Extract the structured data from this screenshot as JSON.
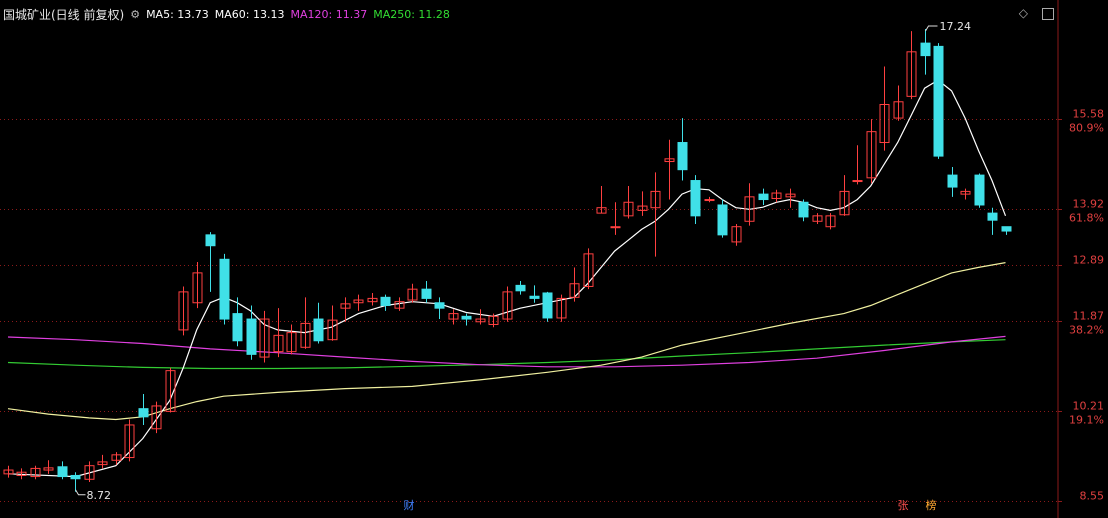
{
  "header": {
    "title": "国城矿业(日线 前复权)",
    "gear_icon": "gear-icon",
    "ma": [
      {
        "text": "MA5: 13.73",
        "color": "#ffffff"
      },
      {
        "text": "MA60: 13.13",
        "color": "#ffffff"
      },
      {
        "text": "MA120: 11.37",
        "color": "#e040e0"
      },
      {
        "text": "MA250: 11.28",
        "color": "#33dd33"
      }
    ]
  },
  "toolbar": {
    "diamond_icon": "diamond-icon",
    "window_icon": "window-icon"
  },
  "badges": {
    "cai": "财",
    "zhang": "张",
    "bang": "榜"
  },
  "colors": {
    "up": "#ff4040",
    "down": "#40e0e8",
    "ma5": "#ffffff",
    "ma60": "#f0f0a0",
    "ma120": "#e040e0",
    "ma250": "#33cc33",
    "grid": "#8b1a1a"
  },
  "chart_data": {
    "type": "candlestick",
    "title": "国城矿业(日线 前复权)",
    "price_range": [
      8.55,
      17.24
    ],
    "y_ticks": [
      {
        "price": 15.58,
        "label": "15.58",
        "pct": "80.9%"
      },
      {
        "price": 13.92,
        "label": "13.92",
        "pct": "61.8%"
      },
      {
        "price": 12.89,
        "label": "12.89",
        "pct": ""
      },
      {
        "price": 11.87,
        "label": "11.87",
        "pct": "38.2%"
      },
      {
        "price": 10.21,
        "label": "10.21",
        "pct": "19.1%"
      },
      {
        "price": 8.55,
        "label": "8.55",
        "pct": ""
      }
    ],
    "annotations": [
      {
        "text": "17.24",
        "type": "high"
      },
      {
        "text": "8.72",
        "type": "low"
      }
    ],
    "candles": [
      [
        9.05,
        9.12,
        8.98,
        9.2
      ],
      [
        9.02,
        9.08,
        8.95,
        9.15
      ],
      [
        9.0,
        9.15,
        8.95,
        9.2
      ],
      [
        9.12,
        9.16,
        9.05,
        9.3
      ],
      [
        9.18,
        9.0,
        8.95,
        9.28
      ],
      [
        9.02,
        8.96,
        8.72,
        9.08
      ],
      [
        8.95,
        9.2,
        8.9,
        9.28
      ],
      [
        9.22,
        9.27,
        9.15,
        9.4
      ],
      [
        9.3,
        9.4,
        9.22,
        9.45
      ],
      [
        9.35,
        9.95,
        9.28,
        10.05
      ],
      [
        10.25,
        10.1,
        9.95,
        10.52
      ],
      [
        9.88,
        10.3,
        9.8,
        10.38
      ],
      [
        10.2,
        10.95,
        10.18,
        11.0
      ],
      [
        11.7,
        12.4,
        11.6,
        12.5
      ],
      [
        12.2,
        12.75,
        12.1,
        12.95
      ],
      [
        13.45,
        13.25,
        12.4,
        13.5
      ],
      [
        13.0,
        11.9,
        11.8,
        13.1
      ],
      [
        12.0,
        11.5,
        11.4,
        12.3
      ],
      [
        11.9,
        11.25,
        11.15,
        12.15
      ],
      [
        11.2,
        11.9,
        11.1,
        12.05
      ],
      [
        11.3,
        11.6,
        11.2,
        12.1
      ],
      [
        11.3,
        11.65,
        11.25,
        11.8
      ],
      [
        11.38,
        11.82,
        11.35,
        12.3
      ],
      [
        11.9,
        11.5,
        11.45,
        12.2
      ],
      [
        11.52,
        11.88,
        11.5,
        12.15
      ],
      [
        12.1,
        12.18,
        11.85,
        12.3
      ],
      [
        12.2,
        12.25,
        12.05,
        12.35
      ],
      [
        12.22,
        12.28,
        12.15,
        12.38
      ],
      [
        12.3,
        12.15,
        12.05,
        12.35
      ],
      [
        12.1,
        12.22,
        12.05,
        12.3
      ],
      [
        12.25,
        12.45,
        12.2,
        12.55
      ],
      [
        12.45,
        12.28,
        12.2,
        12.6
      ],
      [
        12.2,
        12.1,
        11.9,
        12.3
      ],
      [
        11.9,
        12.0,
        11.8,
        12.08
      ],
      [
        11.95,
        11.9,
        11.78,
        12.0
      ],
      [
        11.85,
        11.9,
        11.8,
        12.08
      ],
      [
        11.8,
        11.95,
        11.75,
        12.0
      ],
      [
        11.9,
        12.4,
        11.85,
        12.5
      ],
      [
        12.52,
        12.42,
        12.35,
        12.6
      ],
      [
        12.32,
        12.28,
        12.2,
        12.52
      ],
      [
        12.38,
        11.92,
        11.85,
        12.4
      ],
      [
        11.92,
        12.28,
        11.85,
        12.35
      ],
      [
        12.3,
        12.55,
        12.22,
        12.85
      ],
      [
        12.5,
        13.1,
        12.45,
        13.2
      ],
      [
        13.85,
        13.95,
        13.85,
        14.35
      ],
      [
        13.6,
        13.6,
        13.45,
        14.05
      ],
      [
        13.8,
        14.05,
        13.75,
        14.35
      ],
      [
        13.9,
        13.98,
        13.8,
        14.25
      ],
      [
        13.95,
        14.25,
        13.05,
        14.6
      ],
      [
        14.8,
        14.85,
        14.1,
        15.2
      ],
      [
        15.15,
        14.65,
        14.45,
        15.6
      ],
      [
        14.45,
        13.8,
        13.65,
        14.55
      ],
      [
        14.1,
        14.1,
        14.05,
        14.15
      ],
      [
        14.0,
        13.45,
        13.4,
        14.1
      ],
      [
        13.32,
        13.6,
        13.25,
        13.65
      ],
      [
        13.7,
        14.15,
        13.62,
        14.4
      ],
      [
        14.2,
        14.1,
        14.0,
        14.3
      ],
      [
        14.12,
        14.22,
        14.05,
        14.28
      ],
      [
        14.15,
        14.2,
        13.95,
        14.3
      ],
      [
        14.05,
        13.78,
        13.7,
        14.1
      ],
      [
        13.7,
        13.8,
        13.65,
        13.85
      ],
      [
        13.6,
        13.8,
        13.55,
        13.85
      ],
      [
        13.82,
        14.25,
        13.8,
        14.55
      ],
      [
        14.45,
        14.45,
        14.38,
        15.1
      ],
      [
        14.5,
        15.35,
        14.4,
        15.58
      ],
      [
        15.15,
        15.85,
        15.0,
        16.55
      ],
      [
        15.6,
        15.9,
        15.55,
        16.2
      ],
      [
        16.0,
        16.82,
        15.95,
        17.2
      ],
      [
        16.98,
        16.75,
        16.4,
        17.24
      ],
      [
        16.92,
        14.9,
        14.85,
        16.98
      ],
      [
        14.55,
        14.33,
        14.15,
        14.7
      ],
      [
        14.2,
        14.25,
        14.1,
        14.3
      ],
      [
        14.55,
        14.0,
        13.95,
        14.58
      ],
      [
        13.85,
        13.72,
        13.45,
        13.95
      ],
      [
        13.6,
        13.52,
        13.45,
        13.6
      ]
    ],
    "ma": {
      "MA5": [
        [
          0,
          9.05
        ],
        [
          5,
          9.0
        ],
        [
          8,
          9.2
        ],
        [
          10,
          9.7
        ],
        [
          12,
          10.4
        ],
        [
          13,
          11.0
        ],
        [
          14,
          11.7
        ],
        [
          15,
          12.2
        ],
        [
          16,
          12.3
        ],
        [
          17,
          12.2
        ],
        [
          18,
          12.05
        ],
        [
          19,
          11.8
        ],
        [
          20,
          11.7
        ],
        [
          22,
          11.65
        ],
        [
          24,
          11.75
        ],
        [
          26,
          12.0
        ],
        [
          28,
          12.15
        ],
        [
          30,
          12.22
        ],
        [
          32,
          12.18
        ],
        [
          34,
          12.02
        ],
        [
          36,
          11.95
        ],
        [
          38,
          12.1
        ],
        [
          40,
          12.2
        ],
        [
          42,
          12.3
        ],
        [
          43,
          12.55
        ],
        [
          44,
          12.85
        ],
        [
          45,
          13.15
        ],
        [
          46,
          13.35
        ],
        [
          47,
          13.55
        ],
        [
          48,
          13.7
        ],
        [
          49,
          13.92
        ],
        [
          50,
          14.2
        ],
        [
          51,
          14.3
        ],
        [
          52,
          14.28
        ],
        [
          53,
          14.1
        ],
        [
          54,
          13.95
        ],
        [
          55,
          13.92
        ],
        [
          56,
          13.96
        ],
        [
          57,
          14.05
        ],
        [
          58,
          14.1
        ],
        [
          59,
          14.05
        ],
        [
          60,
          13.95
        ],
        [
          61,
          13.9
        ],
        [
          62,
          13.95
        ],
        [
          63,
          14.1
        ],
        [
          64,
          14.35
        ],
        [
          65,
          14.75
        ],
        [
          66,
          15.15
        ],
        [
          67,
          15.65
        ],
        [
          68,
          16.15
        ],
        [
          69,
          16.3
        ],
        [
          70,
          16.1
        ],
        [
          71,
          15.6
        ],
        [
          72,
          15.0
        ],
        [
          73,
          14.45
        ],
        [
          74,
          13.8
        ]
      ],
      "MA60": [
        [
          0,
          10.25
        ],
        [
          3,
          10.15
        ],
        [
          6,
          10.08
        ],
        [
          8,
          10.05
        ],
        [
          10,
          10.1
        ],
        [
          12,
          10.25
        ],
        [
          14,
          10.38
        ],
        [
          16,
          10.48
        ],
        [
          20,
          10.55
        ],
        [
          25,
          10.62
        ],
        [
          30,
          10.66
        ],
        [
          35,
          10.78
        ],
        [
          40,
          10.92
        ],
        [
          44,
          11.05
        ],
        [
          47,
          11.2
        ],
        [
          50,
          11.42
        ],
        [
          54,
          11.62
        ],
        [
          58,
          11.82
        ],
        [
          62,
          12.0
        ],
        [
          64,
          12.15
        ],
        [
          66,
          12.35
        ],
        [
          68,
          12.55
        ],
        [
          70,
          12.75
        ],
        [
          72,
          12.85
        ],
        [
          74,
          12.94
        ]
      ],
      "MA120": [
        [
          0,
          11.57
        ],
        [
          5,
          11.52
        ],
        [
          10,
          11.45
        ],
        [
          15,
          11.35
        ],
        [
          20,
          11.28
        ],
        [
          25,
          11.2
        ],
        [
          30,
          11.12
        ],
        [
          35,
          11.06
        ],
        [
          40,
          11.02
        ],
        [
          45,
          11.02
        ],
        [
          50,
          11.05
        ],
        [
          55,
          11.1
        ],
        [
          60,
          11.18
        ],
        [
          65,
          11.32
        ],
        [
          70,
          11.48
        ],
        [
          74,
          11.58
        ]
      ],
      "MA250": [
        [
          0,
          11.1
        ],
        [
          5,
          11.05
        ],
        [
          10,
          11.01
        ],
        [
          15,
          10.99
        ],
        [
          20,
          10.99
        ],
        [
          25,
          11.0
        ],
        [
          30,
          11.03
        ],
        [
          35,
          11.06
        ],
        [
          40,
          11.1
        ],
        [
          45,
          11.15
        ],
        [
          50,
          11.22
        ],
        [
          55,
          11.28
        ],
        [
          60,
          11.35
        ],
        [
          65,
          11.42
        ],
        [
          70,
          11.48
        ],
        [
          74,
          11.52
        ]
      ]
    },
    "grid": true
  }
}
